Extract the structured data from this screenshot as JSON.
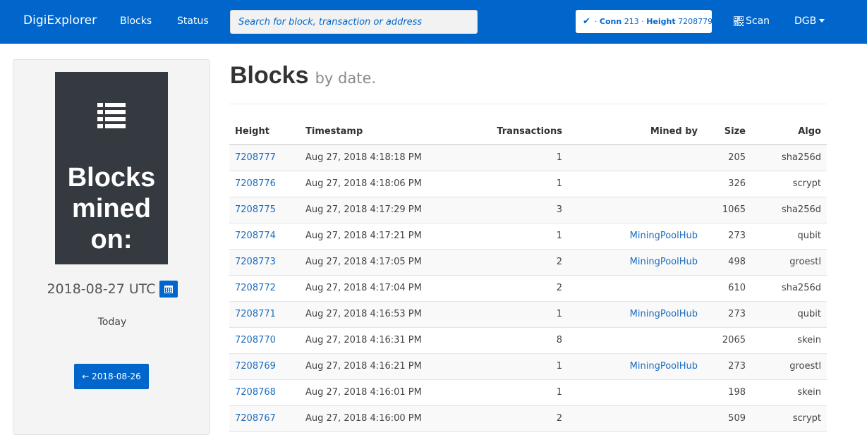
{
  "nav": {
    "brand": "DigiExplorer",
    "blocks": "Blocks",
    "status": "Status",
    "search_placeholder": "Search for block, transaction or address",
    "conn_label": "Conn",
    "conn_value": "213",
    "height_label": "Height",
    "height_value": "7208779",
    "scan": "Scan",
    "coin": "DGB"
  },
  "sidebar": {
    "hero_text": "Blocks mined on:",
    "date": "2018-08-27 UTC",
    "today": "Today",
    "prev_button": "← 2018-08-26"
  },
  "main": {
    "title": "Blocks",
    "subtitle": "by date.",
    "columns": [
      "Height",
      "Timestamp",
      "Transactions",
      "Mined by",
      "Size",
      "Algo"
    ],
    "rows": [
      {
        "height": "7208777",
        "timestamp": "Aug 27, 2018 4:18:18 PM",
        "tx": "1",
        "mined_by": "",
        "size": "205",
        "algo": "sha256d"
      },
      {
        "height": "7208776",
        "timestamp": "Aug 27, 2018 4:18:06 PM",
        "tx": "1",
        "mined_by": "",
        "size": "326",
        "algo": "scrypt"
      },
      {
        "height": "7208775",
        "timestamp": "Aug 27, 2018 4:17:29 PM",
        "tx": "3",
        "mined_by": "",
        "size": "1065",
        "algo": "sha256d"
      },
      {
        "height": "7208774",
        "timestamp": "Aug 27, 2018 4:17:21 PM",
        "tx": "1",
        "mined_by": "MiningPoolHub",
        "size": "273",
        "algo": "qubit"
      },
      {
        "height": "7208773",
        "timestamp": "Aug 27, 2018 4:17:05 PM",
        "tx": "2",
        "mined_by": "MiningPoolHub",
        "size": "498",
        "algo": "groestl"
      },
      {
        "height": "7208772",
        "timestamp": "Aug 27, 2018 4:17:04 PM",
        "tx": "2",
        "mined_by": "",
        "size": "610",
        "algo": "sha256d"
      },
      {
        "height": "7208771",
        "timestamp": "Aug 27, 2018 4:16:53 PM",
        "tx": "1",
        "mined_by": "MiningPoolHub",
        "size": "273",
        "algo": "qubit"
      },
      {
        "height": "7208770",
        "timestamp": "Aug 27, 2018 4:16:31 PM",
        "tx": "8",
        "mined_by": "",
        "size": "2065",
        "algo": "skein"
      },
      {
        "height": "7208769",
        "timestamp": "Aug 27, 2018 4:16:21 PM",
        "tx": "1",
        "mined_by": "MiningPoolHub",
        "size": "273",
        "algo": "groestl"
      },
      {
        "height": "7208768",
        "timestamp": "Aug 27, 2018 4:16:01 PM",
        "tx": "1",
        "mined_by": "",
        "size": "198",
        "algo": "skein"
      },
      {
        "height": "7208767",
        "timestamp": "Aug 27, 2018 4:16:00 PM",
        "tx": "2",
        "mined_by": "",
        "size": "509",
        "algo": "scrypt"
      }
    ]
  },
  "icons": {
    "check": "check-icon",
    "scan": "qr-code-icon",
    "caret": "caret-down-icon",
    "list": "list-icon",
    "calendar": "calendar-icon"
  },
  "colors": {
    "brand": "#0066cc",
    "hero_bg": "#343a40",
    "link": "#1a6dbf"
  }
}
